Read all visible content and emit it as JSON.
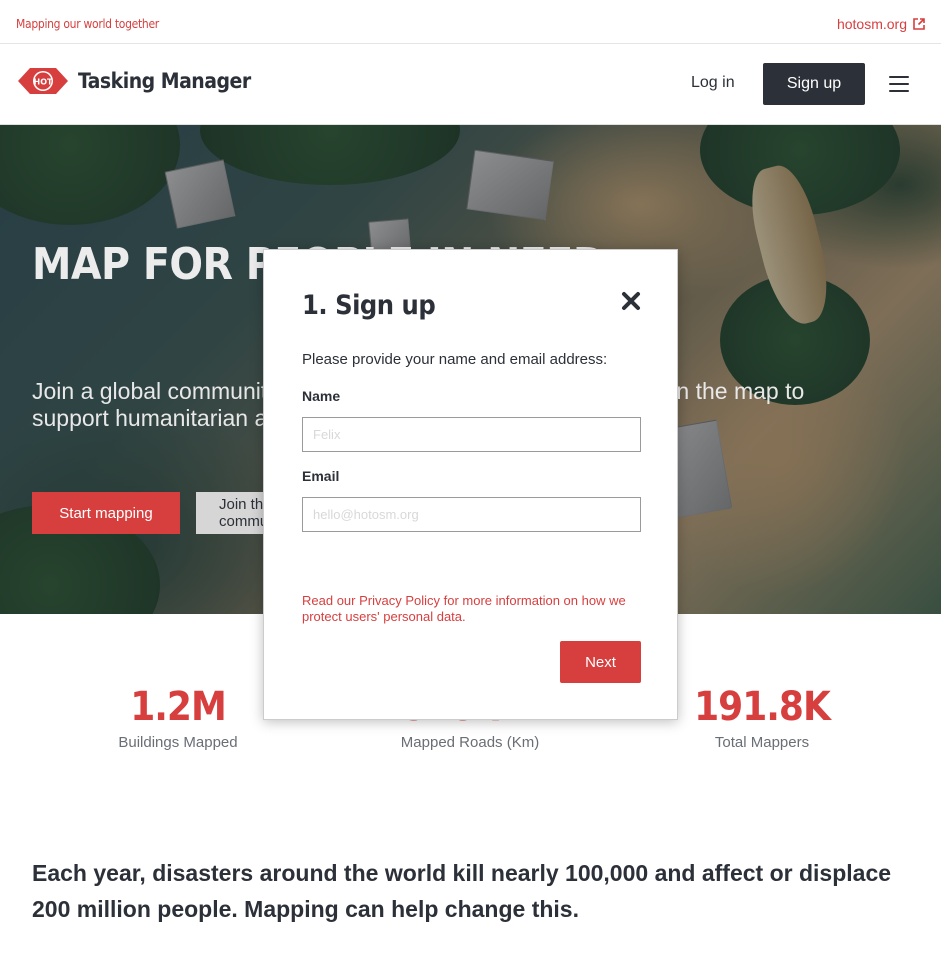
{
  "topbar": {
    "tagline": "Mapping our world together",
    "external_link": "hotosm.org"
  },
  "navbar": {
    "logo_text": "HOT",
    "app_title": "Tasking Manager",
    "login_label": "Log in",
    "signup_label": "Sign up"
  },
  "hero": {
    "heading": "MAP FOR PEOPLE IN NEED",
    "lead": "Join a global community of mappers to put people and places on the map to support humanitarian and sustainable development.",
    "start_mapping_label": "Start mapping",
    "join_label": "Join the community"
  },
  "stats": [
    {
      "value": "1.2M",
      "label": "Buildings Mapped"
    },
    {
      "value": "548.7K",
      "label": "Mapped Roads (Km)"
    },
    {
      "value": "191.8K",
      "label": "Total Mappers"
    }
  ],
  "mission": "Each year, disasters around the world kill nearly 100,000 and affect or displace 200 million people. Mapping can help change this.",
  "modal": {
    "title": "1. Sign up",
    "instructions": "Please provide your name and email address:",
    "name_label": "Name",
    "name_placeholder": "Felix",
    "email_label": "Email",
    "email_placeholder": "hello@hotosm.org",
    "privacy_text": "Read our Privacy Policy for more information on how we protect users' personal data.",
    "next_label": "Next"
  },
  "colors": {
    "accent": "#d73f3f",
    "dark": "#2c3038",
    "light_grey": "#d6d6d6"
  },
  "icons": {
    "external": "external-link-icon",
    "menu": "hamburger-menu-icon",
    "close": "close-icon",
    "logo": "hot-logo-icon"
  }
}
